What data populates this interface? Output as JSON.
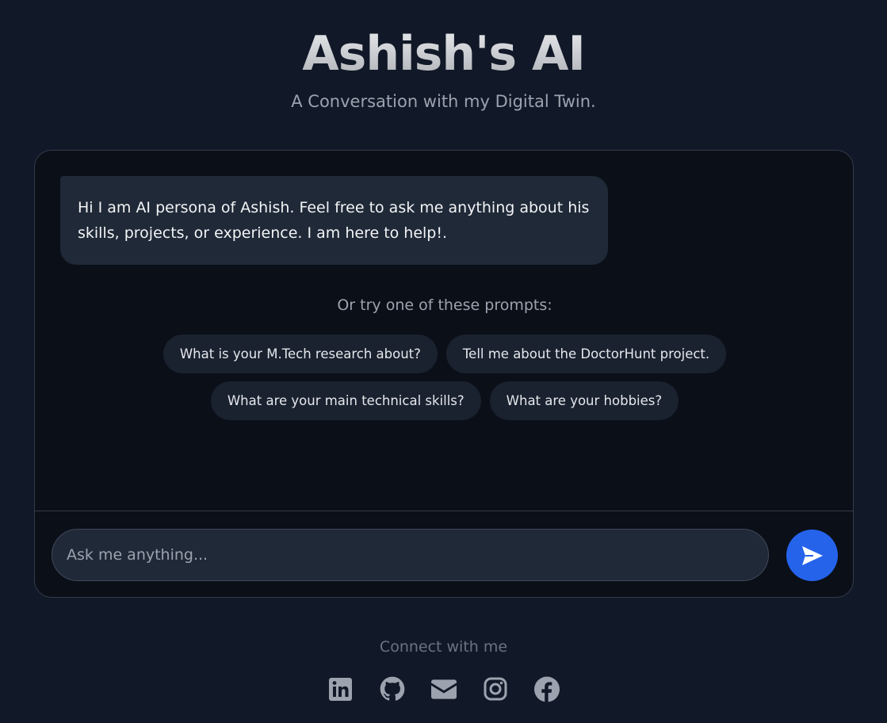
{
  "header": {
    "title": "Ashish's AI",
    "subtitle": "A Conversation with my Digital Twin."
  },
  "chat": {
    "messages": [
      {
        "role": "bot",
        "text": "Hi I am AI persona of Ashish. Feel free to ask me anything about his skills, projects, or experience. I am here to help!."
      }
    ],
    "prompts_label": "Or try one of these prompts:",
    "prompts": [
      "What is your M.Tech research about?",
      "Tell me about the DoctorHunt project.",
      "What are your main technical skills?",
      "What are your hobbies?"
    ],
    "input": {
      "value": "",
      "placeholder": "Ask me anything..."
    },
    "send_icon": "paper-plane-icon"
  },
  "footer": {
    "label": "Connect with me",
    "social_icons": [
      "linkedin-icon",
      "github-icon",
      "mail-icon",
      "instagram-icon",
      "facebook-icon"
    ]
  },
  "colors": {
    "page_background": "#111827",
    "card_background": "#0b0f18",
    "bubble_background": "#1f2937",
    "chip_background": "#1a2230",
    "accent": "#2563eb",
    "icon": "#9ca3af"
  }
}
